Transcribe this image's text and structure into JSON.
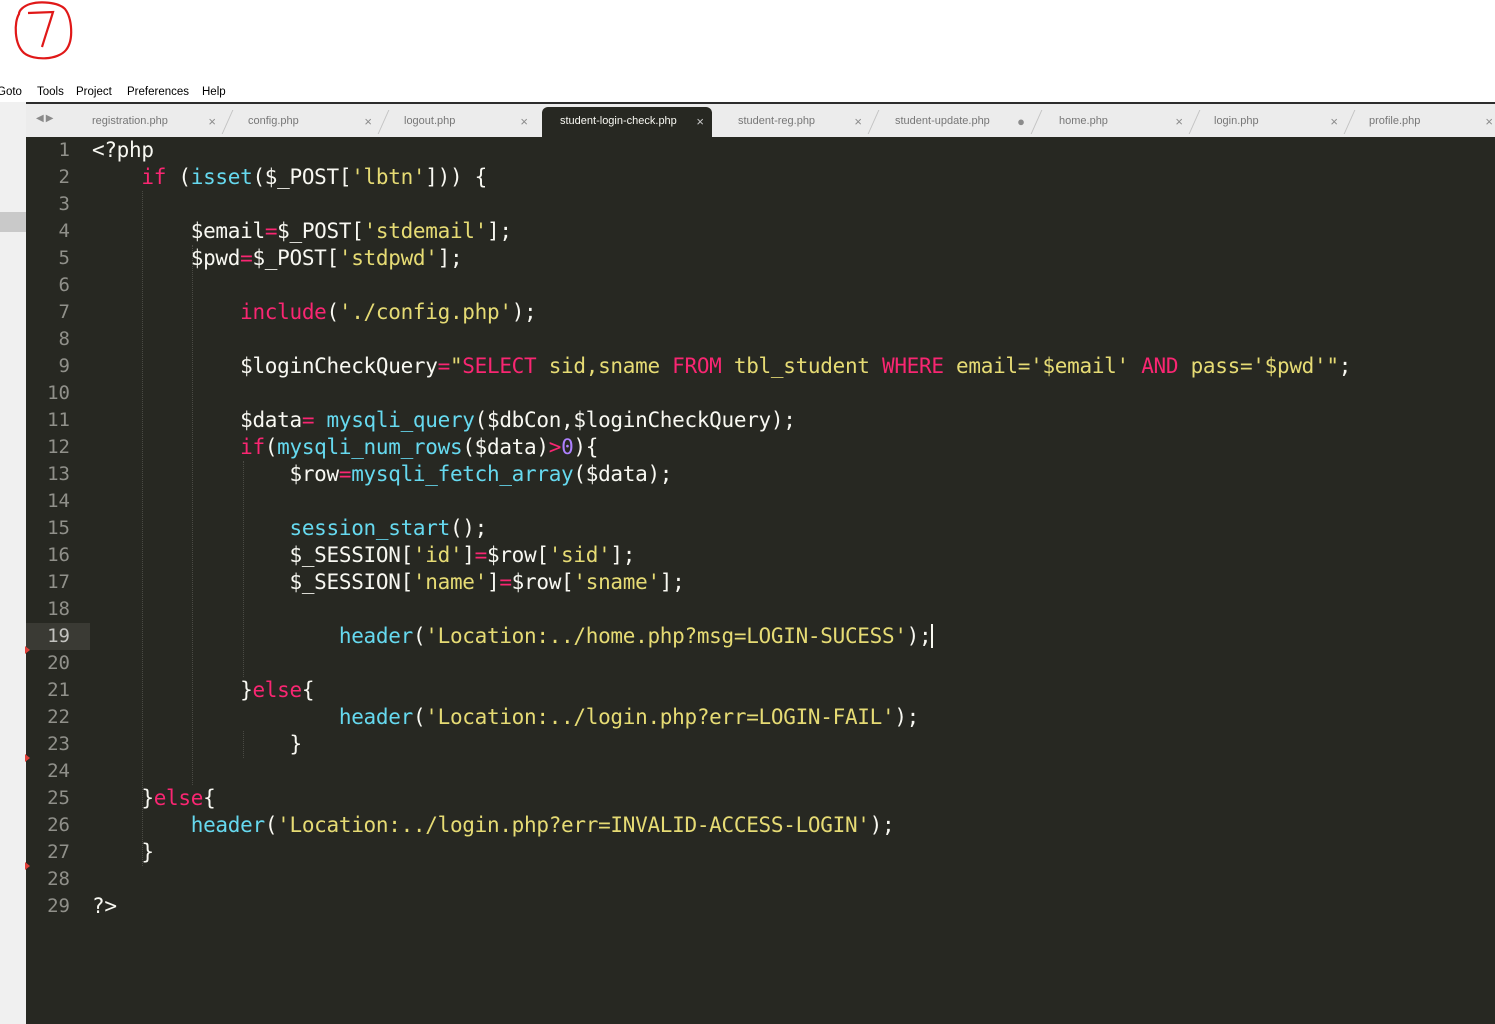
{
  "menu": {
    "items": [
      "Goto",
      "Tools",
      "Project",
      "Preferences",
      "Help"
    ]
  },
  "tabs": [
    {
      "label": "registration.php",
      "close": "×",
      "active": false
    },
    {
      "label": "config.php",
      "close": "×",
      "active": false
    },
    {
      "label": "logout.php",
      "close": "×",
      "active": false
    },
    {
      "label": "student-login-check.php",
      "close": "×",
      "active": true
    },
    {
      "label": "student-reg.php",
      "close": "×",
      "active": false
    },
    {
      "label": "student-update.php",
      "close": "●",
      "active": false
    },
    {
      "label": "home.php",
      "close": "×",
      "active": false
    },
    {
      "label": "login.php",
      "close": "×",
      "active": false
    },
    {
      "label": "profile.php",
      "close": "×",
      "active": false
    }
  ],
  "editor": {
    "current_line": 19,
    "lines": [
      [
        [
          "t",
          "<?php"
        ]
      ],
      [
        [
          "t",
          "    "
        ],
        [
          "k",
          "if"
        ],
        [
          "t",
          " ("
        ],
        [
          "f",
          "isset"
        ],
        [
          "t",
          "($_POST["
        ],
        [
          "s",
          "'lbtn'"
        ],
        [
          "t",
          "])) {"
        ]
      ],
      [],
      [
        [
          "t",
          "        $email"
        ],
        [
          "k",
          "="
        ],
        [
          "t",
          "$_POST["
        ],
        [
          "s",
          "'stdemail'"
        ],
        [
          "t",
          "];"
        ]
      ],
      [
        [
          "t",
          "        $pwd"
        ],
        [
          "k",
          "="
        ],
        [
          "t",
          "$_POST["
        ],
        [
          "s",
          "'stdpwd'"
        ],
        [
          "t",
          "];"
        ]
      ],
      [],
      [
        [
          "t",
          "            "
        ],
        [
          "k",
          "include"
        ],
        [
          "t",
          "("
        ],
        [
          "s",
          "'./config.php'"
        ],
        [
          "t",
          ");"
        ]
      ],
      [],
      [
        [
          "t",
          "            $loginCheckQuery"
        ],
        [
          "k",
          "="
        ],
        [
          "s",
          "\""
        ],
        [
          "k",
          "SELECT"
        ],
        [
          "s",
          " sid,sname "
        ],
        [
          "k",
          "FROM"
        ],
        [
          "s",
          " tbl_student "
        ],
        [
          "k",
          "WHERE"
        ],
        [
          "s",
          " email='$email' "
        ],
        [
          "k",
          "AND"
        ],
        [
          "s",
          " pass='$pwd'\""
        ],
        [
          "t",
          ";"
        ]
      ],
      [],
      [
        [
          "t",
          "            $data"
        ],
        [
          "k",
          "="
        ],
        [
          "t",
          " "
        ],
        [
          "f",
          "mysqli_query"
        ],
        [
          "t",
          "($dbCon,$loginCheckQuery);"
        ]
      ],
      [
        [
          "t",
          "            "
        ],
        [
          "k",
          "if"
        ],
        [
          "t",
          "("
        ],
        [
          "f",
          "mysqli_num_rows"
        ],
        [
          "t",
          "($data)"
        ],
        [
          "k",
          ">"
        ],
        [
          "n",
          "0"
        ],
        [
          "t",
          "){"
        ]
      ],
      [
        [
          "t",
          "                $row"
        ],
        [
          "k",
          "="
        ],
        [
          "f",
          "mysqli_fetch_array"
        ],
        [
          "t",
          "($data);"
        ]
      ],
      [],
      [
        [
          "t",
          "                "
        ],
        [
          "f",
          "session_start"
        ],
        [
          "t",
          "();"
        ]
      ],
      [
        [
          "t",
          "                $_SESSION["
        ],
        [
          "s",
          "'id'"
        ],
        [
          "t",
          "]"
        ],
        [
          "k",
          "="
        ],
        [
          "t",
          "$row["
        ],
        [
          "s",
          "'sid'"
        ],
        [
          "t",
          "];"
        ]
      ],
      [
        [
          "t",
          "                $_SESSION["
        ],
        [
          "s",
          "'name'"
        ],
        [
          "t",
          "]"
        ],
        [
          "k",
          "="
        ],
        [
          "t",
          "$row["
        ],
        [
          "s",
          "'sname'"
        ],
        [
          "t",
          "];"
        ]
      ],
      [],
      [
        [
          "t",
          "                    "
        ],
        [
          "f",
          "header"
        ],
        [
          "t",
          "("
        ],
        [
          "s",
          "'Location:../home.php?msg=LOGIN-SUCESS'"
        ],
        [
          "t",
          ");"
        ]
      ],
      [],
      [
        [
          "t",
          "            }"
        ],
        [
          "k",
          "else"
        ],
        [
          "t",
          "{"
        ]
      ],
      [
        [
          "t",
          "                    "
        ],
        [
          "f",
          "header"
        ],
        [
          "t",
          "("
        ],
        [
          "s",
          "'Location:../login.php?err=LOGIN-FAIL'"
        ],
        [
          "t",
          ");"
        ]
      ],
      [
        [
          "t",
          "                }"
        ]
      ],
      [],
      [
        [
          "t",
          "    }"
        ],
        [
          "k",
          "else"
        ],
        [
          "t",
          "{"
        ]
      ],
      [
        [
          "t",
          "        "
        ],
        [
          "f",
          "header"
        ],
        [
          "t",
          "("
        ],
        [
          "s",
          "'Location:../login.php?err=INVALID-ACCESS-LOGIN'"
        ],
        [
          "t",
          ");"
        ]
      ],
      [
        [
          "t",
          "    }"
        ]
      ],
      [],
      [
        [
          "t",
          "?>"
        ]
      ]
    ]
  }
}
